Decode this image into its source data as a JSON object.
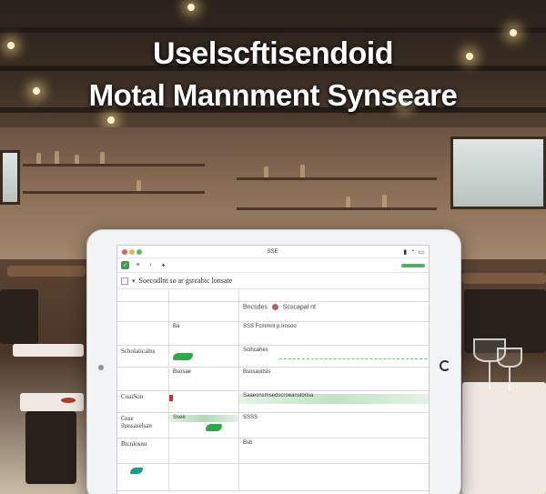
{
  "title": {
    "line1": "Uselscftisendoid",
    "line2": "Motal Mannment Synseare"
  },
  "colors": {
    "accent_green": "#3da04e",
    "teal": "#1f9a8a",
    "warning_red": "#c9342c"
  },
  "window": {
    "title": "SSE",
    "status_icons": [
      "signal-icon",
      "wifi-icon",
      "battery-icon"
    ]
  },
  "toolbar": {
    "icons": [
      "check-icon",
      "menu-icon",
      "back-icon",
      "star-icon"
    ]
  },
  "search": {
    "text": "Soecodlnt so ar gsrcabic lonsate"
  },
  "table": {
    "header": {
      "col3": "Bncsdes",
      "col3b": "Scscapal nt"
    },
    "rows": [
      {
        "col1": "",
        "col2": "",
        "col3": ""
      },
      {
        "col1": "",
        "col2": "Ba",
        "col3": "SSS Fcmmnt p.Irnsoo"
      },
      {
        "col1": "Scholaiicalns",
        "col2": "",
        "col3": "Scihcahes"
      },
      {
        "col1": "",
        "col2": "Bsosae",
        "col3": "Bsosaoitsis"
      },
      {
        "col1": "CoaiSon",
        "col2": "",
        "col3": "Saaeonsmsedscroeanstorisa"
      },
      {
        "col1": "Gsse ihsssaselsan",
        "col2": "Ssee",
        "col3": "SSSS"
      },
      {
        "col1": "Btcnlosnu",
        "col2": "",
        "col3": "Bsb"
      },
      {
        "col1": "",
        "col2": "",
        "col3": ""
      }
    ]
  }
}
